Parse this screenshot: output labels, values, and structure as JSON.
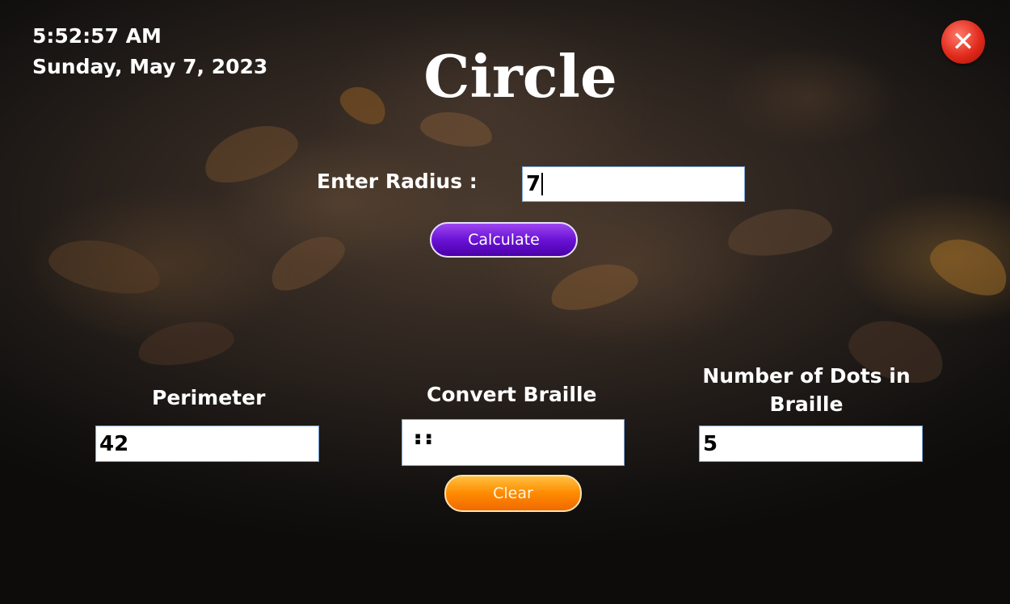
{
  "window": {
    "title": "Circle",
    "close_icon": "close-icon"
  },
  "clock": {
    "time": "5:52:57 AM",
    "date": "Sunday, May 7, 2023"
  },
  "input": {
    "radius_label": "Enter Radius :",
    "radius_value": "7"
  },
  "buttons": {
    "calculate_label": "Calculate",
    "clear_label": "Clear"
  },
  "results": {
    "perimeter_label": "Perimeter",
    "perimeter_value": "42",
    "braille_label": "Convert Braille",
    "braille_value": "⠰⠆",
    "dots_label": "Number of Dots in Braille",
    "dots_value": "5"
  },
  "colors": {
    "calculate_button": "#6a12d6",
    "clear_button": "#ff8a00",
    "close_button": "#e02a1c"
  }
}
